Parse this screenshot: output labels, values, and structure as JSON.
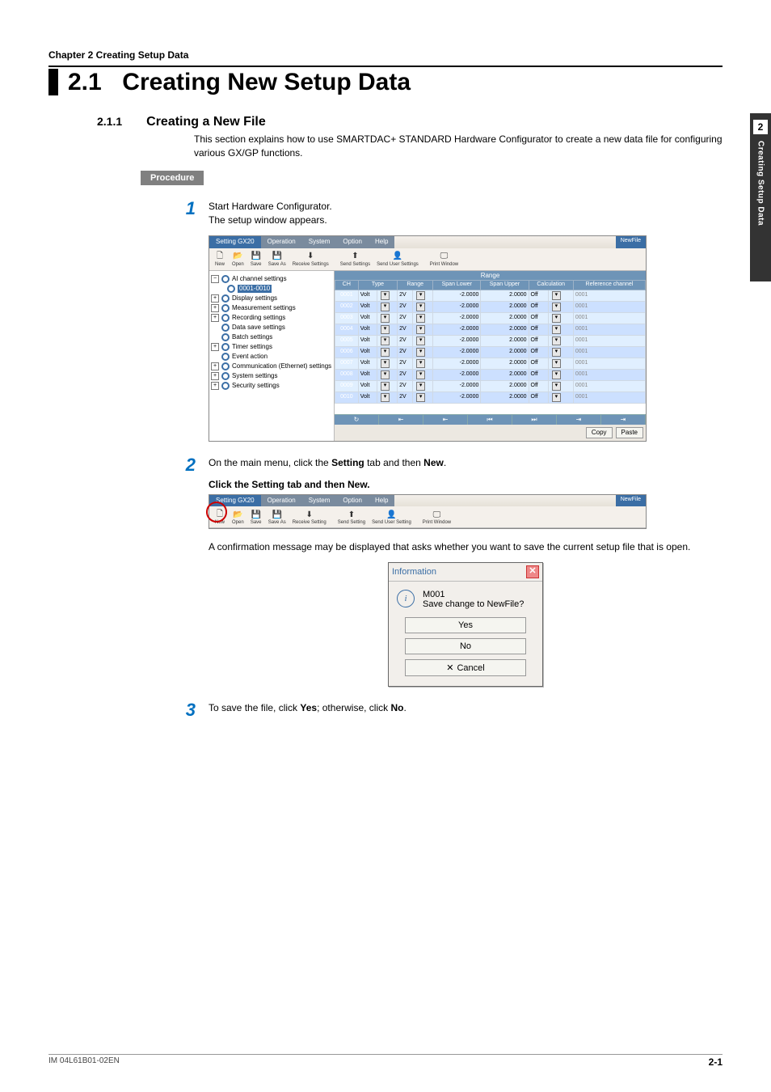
{
  "page": {
    "chapter_header": "Chapter  2   Creating Setup Data",
    "section_number": "2.1",
    "section_title": "Creating New Setup Data",
    "sub_number": "2.1.1",
    "sub_title": "Creating a New File",
    "intro": "This section explains how to use SMARTDAC+ STANDARD Hardware Configurator to create a new data file for configuring various GX/GP functions.",
    "procedure_label": "Procedure",
    "side_tab": {
      "number": "2",
      "label": "Creating Setup Data"
    },
    "footer": {
      "doc_id": "IM 04L61B01-02EN",
      "page_num": "2-1"
    }
  },
  "steps": {
    "s1": {
      "num": "1",
      "line1": "Start Hardware Configurator.",
      "line2": "The setup window appears."
    },
    "s2": {
      "num": "2",
      "line_parts": [
        "On the main menu, click the ",
        "Setting",
        " tab and then ",
        "New",
        "."
      ],
      "caption": "Click the Setting tab and then New.",
      "after": "A confirmation message may be displayed that asks whether you want to save the current setup file that is open."
    },
    "s3": {
      "num": "3",
      "line_parts": [
        "To save the file, click ",
        "Yes",
        "; otherwise, click ",
        "No",
        "."
      ]
    }
  },
  "app_window": {
    "tabs": [
      "Setting GX20",
      "Operation",
      "System",
      "Option",
      "Help"
    ],
    "file_tag": "NewFile",
    "toolbar": [
      {
        "icon": "🗋",
        "label": "New"
      },
      {
        "icon": "📂",
        "label": "Open"
      },
      {
        "icon": "💾",
        "label": "Save"
      },
      {
        "icon": "💾",
        "label": "Save As"
      },
      {
        "icon": "⬇",
        "label": "Receive Settings"
      },
      {
        "icon": "⬆",
        "label": "Send Settings"
      },
      {
        "icon": "👤",
        "label": "Send User Settings"
      },
      {
        "icon": "🖵",
        "label": "Print Window"
      }
    ],
    "tree": [
      {
        "label": "AI channel settings",
        "expandable": true,
        "children": [
          {
            "label": "0001-0010",
            "selected": true
          }
        ]
      },
      {
        "label": "Display settings",
        "expandable": true
      },
      {
        "label": "Measurement settings",
        "expandable": true
      },
      {
        "label": "Recording settings",
        "expandable": true
      },
      {
        "label": "Data save settings",
        "expandable": false
      },
      {
        "label": "Batch settings",
        "expandable": false
      },
      {
        "label": "Timer settings",
        "expandable": true
      },
      {
        "label": "Event action",
        "expandable": false
      },
      {
        "label": "Communication (Ethernet) settings",
        "expandable": true
      },
      {
        "label": "System settings",
        "expandable": true
      },
      {
        "label": "Security settings",
        "expandable": true
      }
    ],
    "grid": {
      "range_header": "Range",
      "columns": [
        "CH",
        "Type",
        "Range",
        "Span Lower",
        "Span Upper",
        "Calculation",
        "Reference channel"
      ],
      "rows": [
        {
          "ch": "0001",
          "type": "Volt",
          "range": "2V",
          "lower": "-2.0000",
          "upper": "2.0000",
          "calc": "Off",
          "ref": "0001"
        },
        {
          "ch": "0002",
          "type": "Volt",
          "range": "2V",
          "lower": "-2.0000",
          "upper": "2.0000",
          "calc": "Off",
          "ref": "0001"
        },
        {
          "ch": "0003",
          "type": "Volt",
          "range": "2V",
          "lower": "-2.0000",
          "upper": "2.0000",
          "calc": "Off",
          "ref": "0001"
        },
        {
          "ch": "0004",
          "type": "Volt",
          "range": "2V",
          "lower": "-2.0000",
          "upper": "2.0000",
          "calc": "Off",
          "ref": "0001"
        },
        {
          "ch": "0005",
          "type": "Volt",
          "range": "2V",
          "lower": "-2.0000",
          "upper": "2.0000",
          "calc": "Off",
          "ref": "0001"
        },
        {
          "ch": "0006",
          "type": "Volt",
          "range": "2V",
          "lower": "-2.0000",
          "upper": "2.0000",
          "calc": "Off",
          "ref": "0001"
        },
        {
          "ch": "0007",
          "type": "Volt",
          "range": "2V",
          "lower": "-2.0000",
          "upper": "2.0000",
          "calc": "Off",
          "ref": "0001"
        },
        {
          "ch": "0008",
          "type": "Volt",
          "range": "2V",
          "lower": "-2.0000",
          "upper": "2.0000",
          "calc": "Off",
          "ref": "0001"
        },
        {
          "ch": "0009",
          "type": "Volt",
          "range": "2V",
          "lower": "-2.0000",
          "upper": "2.0000",
          "calc": "Off",
          "ref": "0001"
        },
        {
          "ch": "0010",
          "type": "Volt",
          "range": "2V",
          "lower": "-2.0000",
          "upper": "2.0000",
          "calc": "Off",
          "ref": "0001"
        }
      ]
    },
    "nav_icons": [
      "↻",
      "⇤",
      "⇤",
      "⏮",
      "⏭",
      "⇥",
      "⇥"
    ],
    "buttons": {
      "copy": "Copy",
      "paste": "Paste"
    }
  },
  "toolbar_strip": {
    "tabs": [
      "Setting GX20",
      "Operation",
      "System",
      "Option",
      "Help"
    ],
    "file_tag": "NewFile",
    "toolbar": [
      {
        "icon": "🗋",
        "label": "New"
      },
      {
        "icon": "📂",
        "label": "Open"
      },
      {
        "icon": "💾",
        "label": "Save"
      },
      {
        "icon": "💾",
        "label": "Save As"
      },
      {
        "icon": "⬇",
        "label": "Receive Setting"
      },
      {
        "icon": "⬆",
        "label": "Send Setting"
      },
      {
        "icon": "👤",
        "label": "Send User Setting"
      },
      {
        "icon": "🖵",
        "label": "Print Window"
      }
    ]
  },
  "dialog": {
    "title": "Information",
    "code": "M001",
    "message": "Save change to NewFile?",
    "buttons": {
      "yes": "Yes",
      "no": "No",
      "cancel": "Cancel"
    }
  }
}
